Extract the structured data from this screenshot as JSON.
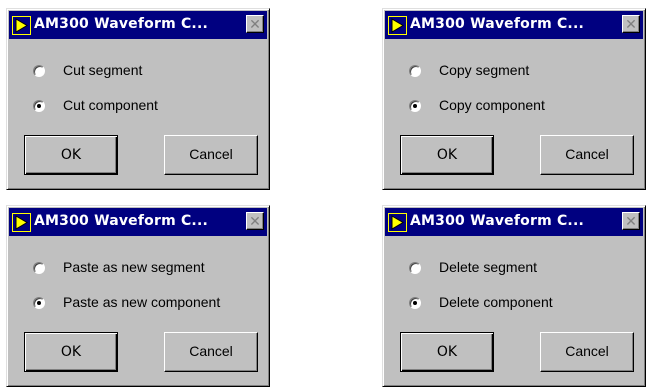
{
  "dialogs": [
    {
      "title": "AM300 Waveform C...",
      "options": [
        {
          "label": "Cut segment",
          "selected": false
        },
        {
          "label": "Cut component",
          "selected": true
        }
      ],
      "ok_label": "OK",
      "cancel_label": "Cancel"
    },
    {
      "title": "AM300 Waveform C...",
      "options": [
        {
          "label": "Copy segment",
          "selected": false
        },
        {
          "label": "Copy component",
          "selected": true
        }
      ],
      "ok_label": "OK",
      "cancel_label": "Cancel"
    },
    {
      "title": "AM300 Waveform C...",
      "options": [
        {
          "label": "Paste as new segment",
          "selected": false
        },
        {
          "label": "Paste as new component",
          "selected": true
        }
      ],
      "ok_label": "OK",
      "cancel_label": "Cancel"
    },
    {
      "title": "AM300 Waveform C...",
      "options": [
        {
          "label": "Delete segment",
          "selected": false
        },
        {
          "label": "Delete component",
          "selected": true
        }
      ],
      "ok_label": "OK",
      "cancel_label": "Cancel"
    }
  ],
  "colors": {
    "window_bg": "#c0c0c0",
    "titlebar_bg": "#000080",
    "titlebar_text": "#ffffff",
    "icon_arrow": "#ffff00"
  },
  "icons": {
    "app_icon": "labview-run-arrow-icon",
    "close_icon": "close-x-icon"
  }
}
